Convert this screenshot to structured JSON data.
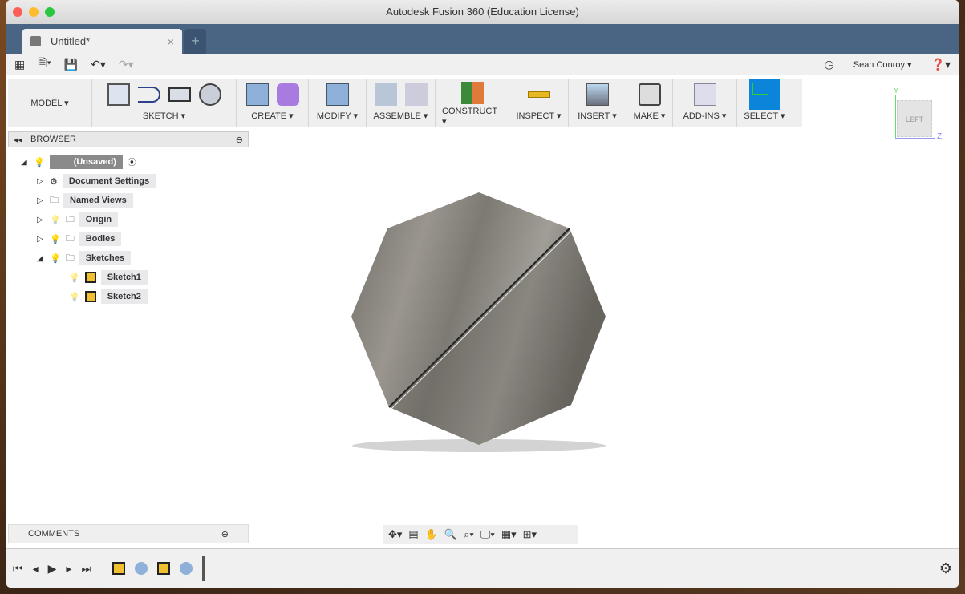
{
  "window": {
    "title": "Autodesk Fusion 360 (Education License)"
  },
  "tabs": [
    {
      "label": "Untitled*",
      "close": "×"
    }
  ],
  "new_tab": "+",
  "user": {
    "name": "Sean Conroy ▾"
  },
  "workspace": "MODEL ▾",
  "ribbon": [
    {
      "label": "SKETCH ▾"
    },
    {
      "label": "CREATE ▾"
    },
    {
      "label": "MODIFY ▾"
    },
    {
      "label": "ASSEMBLE ▾"
    },
    {
      "label": "CONSTRUCT ▾"
    },
    {
      "label": "INSPECT ▾"
    },
    {
      "label": "INSERT ▾"
    },
    {
      "label": "MAKE ▾"
    },
    {
      "label": "ADD-INS ▾"
    },
    {
      "label": "SELECT ▾"
    }
  ],
  "browser": {
    "title": "BROWSER",
    "root": "(Unsaved)",
    "items": [
      {
        "label": "Document Settings",
        "icon": "gear-icon"
      },
      {
        "label": "Named Views",
        "icon": "folder-icon"
      },
      {
        "label": "Origin",
        "icon": "folder-icon"
      },
      {
        "label": "Bodies",
        "icon": "folder-icon"
      },
      {
        "label": "Sketches",
        "icon": "folder-icon"
      },
      {
        "label": "Sketch1",
        "icon": "sketch-icon"
      },
      {
        "label": "Sketch2",
        "icon": "sketch-icon"
      }
    ]
  },
  "viewcube": {
    "face": "LEFT",
    "axis_y": "Y",
    "axis_z": "Z"
  },
  "comments": {
    "title": "COMMENTS"
  },
  "colors": {
    "tabbar": "#4a6584",
    "select_active": "#0a85d9",
    "body": "#8a8680"
  }
}
